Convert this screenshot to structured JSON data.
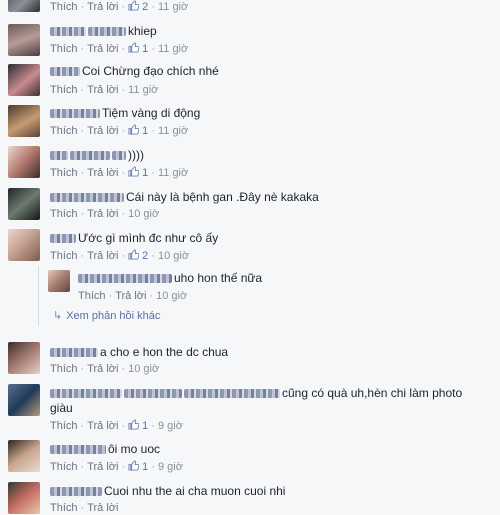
{
  "labels": {
    "like": "Thích",
    "reply": "Trả lời",
    "more_replies": "Xem phản hồi khác"
  },
  "comments": [
    {
      "text": "",
      "likes": "2",
      "time": "11 giờ"
    },
    {
      "text": "khiep",
      "likes": "1",
      "time": "11 giờ"
    },
    {
      "text": "Coi Chừng đạo chích nhé",
      "likes": "",
      "time": "11 giờ"
    },
    {
      "text": "Tiệm vàng di động",
      "likes": "1",
      "time": "11 giờ"
    },
    {
      "text": "))))",
      "likes": "1",
      "time": "11 giờ"
    },
    {
      "text": "Cái này là bệnh gan .Đây nè kakaka",
      "likes": "",
      "time": "10 giờ"
    },
    {
      "text": "Ước gì mình đc như cô ấy",
      "likes": "2",
      "time": "10 giờ"
    },
    {
      "text": "uho hon thế nữa",
      "likes": "",
      "time": "10 giờ"
    },
    {
      "text": "a cho e hon the dc chua",
      "likes": "",
      "time": "10 giờ"
    },
    {
      "text": "cũng có quà uh,hèn chi làm photo",
      "text2": "giàu",
      "likes": "1",
      "time": "9 giờ"
    },
    {
      "text": "ôi mo uoc",
      "likes": "1",
      "time": "9 giờ"
    },
    {
      "text": "Cuoi nhu the ai cha muon cuoi nhi",
      "likes": "",
      "time": ""
    }
  ],
  "colors": {
    "link": "#5b6fa0",
    "meta": "#8a8f99",
    "background": "#f6f7f9"
  }
}
